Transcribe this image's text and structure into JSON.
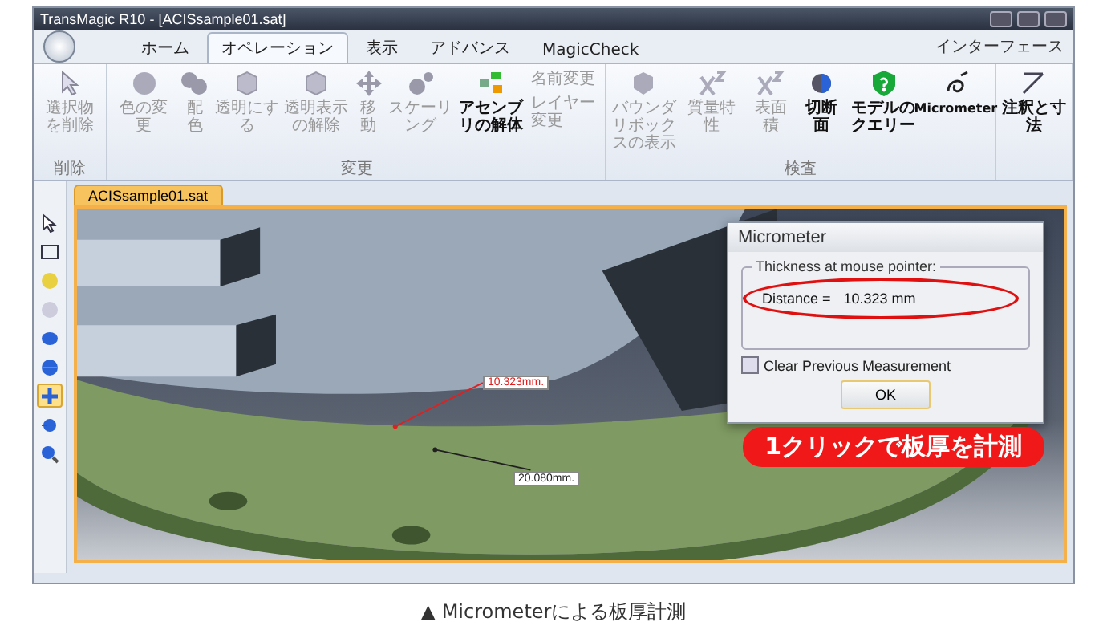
{
  "window": {
    "title": "TransMagic R10 - [ACISsample01.sat]"
  },
  "tabs": [
    {
      "label": "ホーム",
      "selected": false
    },
    {
      "label": "オペレーション",
      "selected": true
    },
    {
      "label": "表示",
      "selected": false
    },
    {
      "label": "アドバンス",
      "selected": false
    },
    {
      "label": "MagicCheck",
      "selected": false
    }
  ],
  "interface_menu": "インターフェース",
  "ribbon": {
    "groups": [
      {
        "label": "削除",
        "buttons": [
          {
            "label": "選択物を削除",
            "kind": "cursor",
            "disabled": true
          }
        ]
      },
      {
        "label": "変更",
        "buttons": [
          {
            "label": "色の変更",
            "kind": "sphere",
            "disabled": true
          },
          {
            "label": "配色",
            "kind": "spheres",
            "disabled": true
          },
          {
            "label": "透明にする",
            "kind": "cube",
            "disabled": true
          },
          {
            "label": "透明表示の解除",
            "kind": "cube",
            "disabled": true
          },
          {
            "label": "移動",
            "kind": "move",
            "disabled": true
          },
          {
            "label": "スケーリング",
            "kind": "scale",
            "disabled": true
          },
          {
            "label": "アセンブリの解体",
            "kind": "assembly",
            "disabled": false
          },
          {
            "label": "名前変更",
            "kind": "small",
            "disabled": true
          },
          {
            "label": "レイヤー変更",
            "kind": "small",
            "disabled": true
          }
        ]
      },
      {
        "label": "検査",
        "buttons": [
          {
            "label": "バウンダリボックスの表示",
            "kind": "bbox",
            "disabled": true
          },
          {
            "label": "質量特性",
            "kind": "x3",
            "disabled": true
          },
          {
            "label": "表面積",
            "kind": "x2",
            "disabled": true
          },
          {
            "label": "切断面",
            "kind": "section",
            "disabled": false
          },
          {
            "label": "モデルのクエリー",
            "kind": "query",
            "disabled": false
          },
          {
            "label": "Micrometer",
            "kind": "micrometer",
            "disabled": false
          }
        ]
      },
      {
        "buttons": [
          {
            "label": "注釈と寸法",
            "kind": "annotate",
            "disabled": false
          }
        ]
      }
    ]
  },
  "toolbar": [
    {
      "kind": "pointer",
      "selected": false
    },
    {
      "kind": "rect",
      "selected": false
    },
    {
      "kind": "star",
      "selected": false
    },
    {
      "kind": "ball",
      "selected": false
    },
    {
      "kind": "view-top",
      "selected": false
    },
    {
      "kind": "view-side",
      "selected": false
    },
    {
      "kind": "pan",
      "selected": true
    },
    {
      "kind": "rotate",
      "selected": false
    },
    {
      "kind": "zoom",
      "selected": false
    }
  ],
  "document_tab": "ACISsample01.sat",
  "measurements": [
    {
      "label": "10.323mm.",
      "color": "#e02020"
    },
    {
      "label": "20.080mm.",
      "color": "#202020"
    }
  ],
  "dialog": {
    "title": "Micrometer",
    "group": "Thickness at mouse pointer:",
    "distance_label": "Distance =",
    "distance_value": "10.323 mm",
    "checkbox": {
      "label": "Clear Previous Measurement",
      "checked": false
    },
    "button": "OK"
  },
  "callout": "1クリックで板厚を計測",
  "caption": "▲ Micrometerによる板厚計測"
}
